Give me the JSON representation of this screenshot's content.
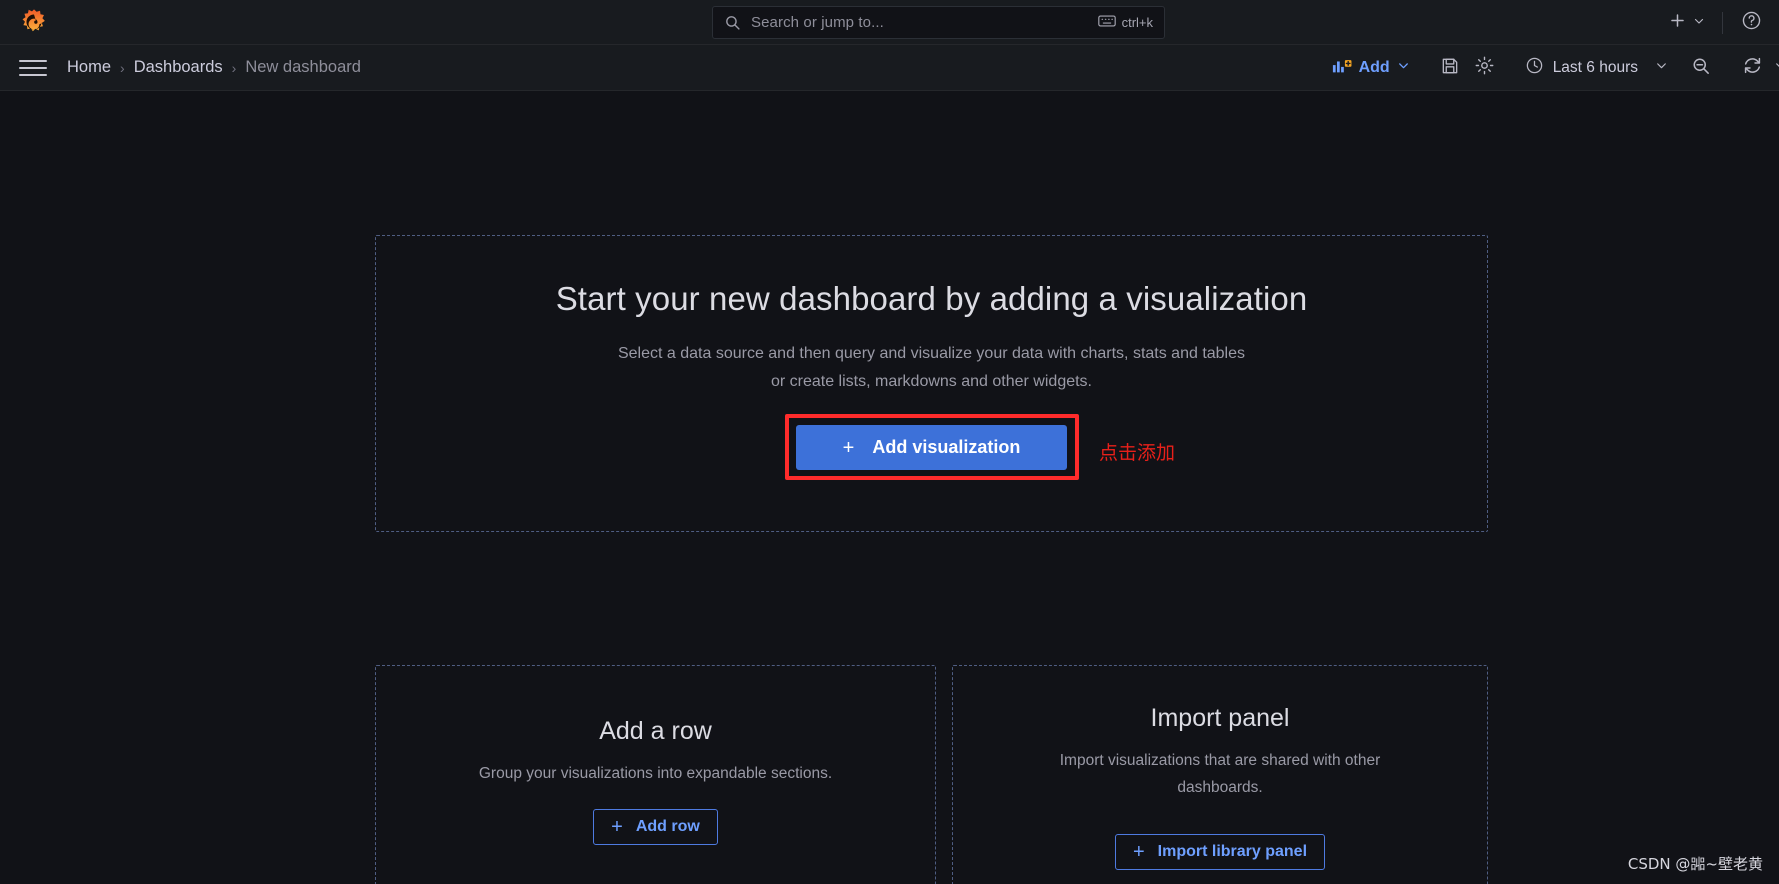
{
  "colors": {
    "accent_blue": "#6e9fff",
    "primary_button": "#3d71d9",
    "annotation_red": "#e8201a",
    "highlight_border": "#ff2b2b",
    "page_bg": "#111217",
    "chrome_bg": "#181b1f",
    "dashed_border": "#4f5d82",
    "logo_orange": "#f05a28"
  },
  "topnav": {
    "logo_name": "grafana-logo",
    "search": {
      "placeholder": "Search or jump to...",
      "shortcut": "ctrl+k",
      "icon": "search-icon",
      "keyboard_icon": "keyboard-icon"
    },
    "actions": {
      "new_label": "+",
      "new_icon": "plus-icon",
      "new_chevron": "chevron-down-icon",
      "help_icon": "help-circle-icon"
    }
  },
  "toolbar": {
    "menu_icon": "hamburger-menu-icon",
    "breadcrumb": [
      {
        "label": "Home",
        "current": false
      },
      {
        "label": "Dashboards",
        "current": false
      },
      {
        "label": "New dashboard",
        "current": true
      }
    ],
    "separator": "›",
    "add": {
      "label": "Add",
      "icon": "add-panel-icon",
      "chevron": "chevron-down-icon"
    },
    "save_icon": "save-disk-icon",
    "settings_icon": "gear-icon",
    "time_range": {
      "label": "Last 6 hours",
      "icon": "clock-icon",
      "chevron": "chevron-down-icon"
    },
    "zoom_out_icon": "zoom-out-icon",
    "refresh_icon": "refresh-icon",
    "refresh_chevron": "chevron-down-icon"
  },
  "hero": {
    "title": "Start your new dashboard by adding a visualization",
    "subtitle_line1": "Select a data source and then query and visualize your data with charts, stats and tables",
    "subtitle_line2": "or create lists, markdowns and other widgets.",
    "cta_label": "Add visualization",
    "cta_plus": "+",
    "annotation": "点击添加"
  },
  "cards": [
    {
      "id": "add-row",
      "title": "Add a row",
      "description": "Group your visualizations into expandable sections.",
      "button_label": "Add row",
      "button_plus": "+"
    },
    {
      "id": "import-panel",
      "title": "Import panel",
      "description": "Import visualizations that are shared with other dashboards.",
      "button_label": "Import library panel",
      "button_plus": "+"
    }
  ],
  "watermark": "CSDN @嘂~壁老黄"
}
